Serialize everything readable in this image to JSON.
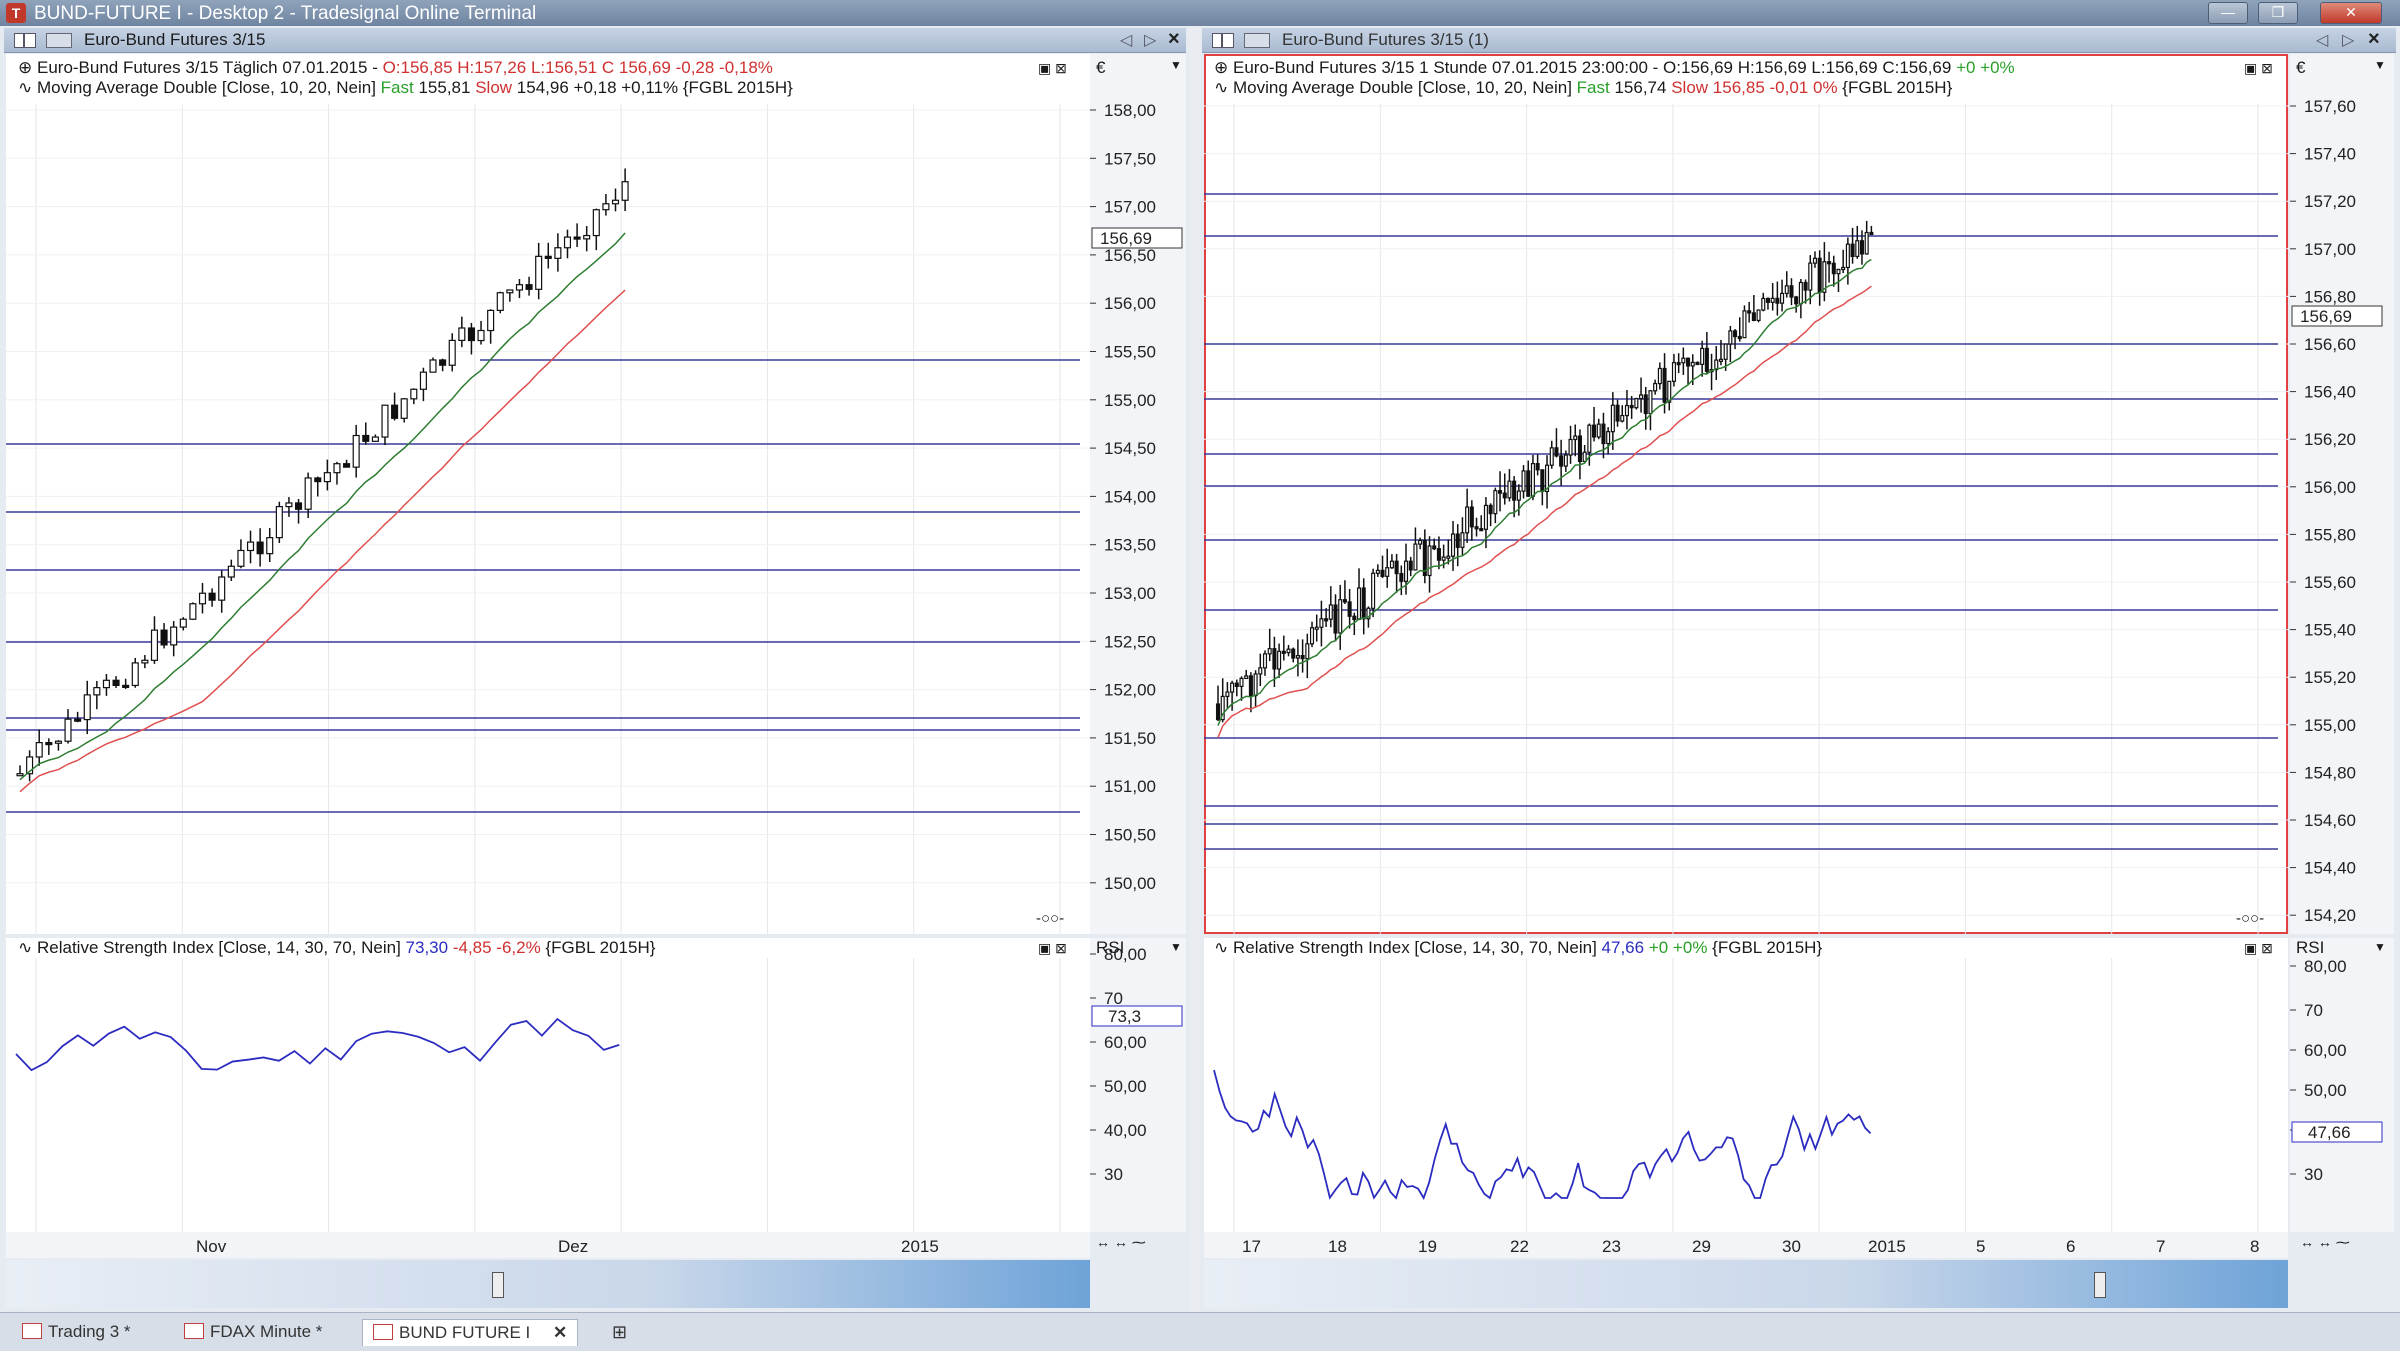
{
  "window": {
    "title": "BUND-FUTURE I - Desktop 2 - Tradesignal Online Terminal"
  },
  "left_panel": {
    "tab_title": "Euro-Bund Futures 3/15",
    "legend1": {
      "name": "Euro-Bund Futures 3/15 Täglich",
      "time": "07.01.2015",
      "ohlc": "O:156,85 H:157,26 L:156,51 C 156,69 -0,28 -0,18%"
    },
    "legend2": {
      "name": "Moving Average Double [Close, 10, 20, Nein]",
      "fast_label": "Fast",
      "fast_val": "155,81",
      "slow_label": "Slow",
      "slow_val": "154,96 +0,18 +0,11%",
      "symbol": "{FGBL 2015H}"
    },
    "currency": "€",
    "price_ticks": [
      "158,00",
      "157,50",
      "157,00",
      "156,50",
      "156,00",
      "155,50",
      "155,00",
      "154,50",
      "154,00",
      "153,50",
      "153,00",
      "152,50",
      "152,00",
      "151,50",
      "151,00",
      "150,50",
      "150,00"
    ],
    "last_price": "156,69",
    "rsi_legend": {
      "name": "Relative Strength Index [Close, 14, 30, 70, Nein]",
      "val": "73,30",
      "chg": "-4,85 -6,2%",
      "symbol": "{FGBL 2015H}"
    },
    "rsi_label": "RSI",
    "rsi_ticks": [
      "80,00",
      "70",
      "60,00",
      "50,00",
      "40,00",
      "30"
    ],
    "rsi_last": "73,3",
    "x_ticks": [
      "Nov",
      "Dez",
      "2015"
    ]
  },
  "right_panel": {
    "tab_title": "Euro-Bund Futures 3/15 (1)",
    "legend1": {
      "name": "Euro-Bund Futures 3/15 1 Stunde",
      "time": "07.01.2015 23:00:00",
      "ohlc": "O:156,69 H:156,69 L:156,69 C:156,69",
      "chg": "+0 +0%"
    },
    "legend2": {
      "name": "Moving Average Double [Close, 10, 20, Nein]",
      "fast_label": "Fast",
      "fast_val": "156,74",
      "slow_label": "Slow",
      "slow_val": "156,85 -0,01 0%",
      "symbol": "{FGBL 2015H}"
    },
    "currency": "€",
    "price_ticks": [
      "157,60",
      "157,40",
      "157,20",
      "157,00",
      "156,80",
      "156,60",
      "156,40",
      "156,20",
      "156,00",
      "155,80",
      "155,60",
      "155,40",
      "155,20",
      "155,00",
      "154,80",
      "154,60",
      "154,40",
      "154,20"
    ],
    "last_price": "156,69",
    "rsi_legend": {
      "name": "Relative Strength Index [Close, 14, 30, 70, Nein]",
      "val": "47,66",
      "chg": "+0 +0%",
      "symbol": "{FGBL 2015H}"
    },
    "rsi_label": "RSI",
    "rsi_ticks": [
      "80,00",
      "70",
      "60,00",
      "50,00",
      "40,00",
      "30"
    ],
    "rsi_last": "47,66",
    "x_ticks": [
      "17",
      "18",
      "19",
      "22",
      "23",
      "29",
      "30",
      "2015",
      "5",
      "6",
      "7",
      "8"
    ]
  },
  "tabs": [
    {
      "label": "Trading 3 *"
    },
    {
      "label": "FDAX Minute *"
    },
    {
      "label": "BUND FUTURE I"
    }
  ],
  "colors": {
    "fast_ma": "#2e7d32",
    "slow_ma": "#e05050",
    "rsi": "#2c2cc0",
    "hline": "#3a3a9a",
    "candle": "#111111",
    "active_border": "#e04040"
  }
}
